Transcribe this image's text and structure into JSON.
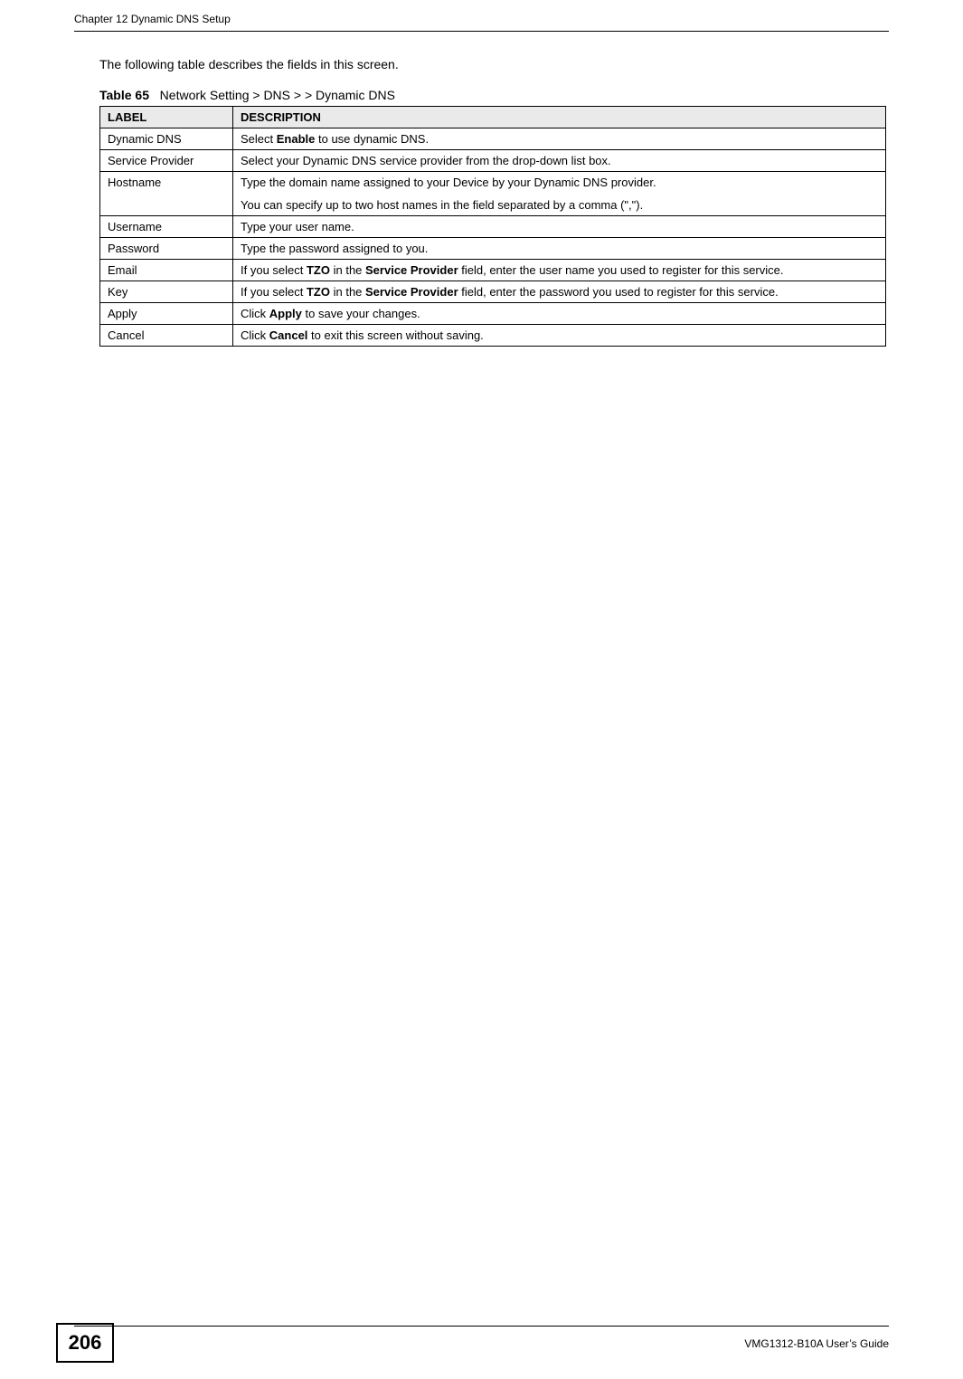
{
  "header": {
    "chapter": "Chapter 12 Dynamic DNS Setup"
  },
  "intro": "The following table describes the fields in this screen.",
  "table": {
    "caption_label": "Table 65",
    "caption_text": "Network Setting > DNS > > Dynamic DNS",
    "headers": {
      "label": "LABEL",
      "description": "DESCRIPTION"
    },
    "rows": {
      "dynamic_dns": {
        "label": "Dynamic DNS",
        "desc_pre": "Select ",
        "desc_bold": "Enable",
        "desc_post": " to use dynamic DNS."
      },
      "service_provider": {
        "label": "Service Provider",
        "desc": "Select your Dynamic DNS service provider from the drop-down list box."
      },
      "hostname": {
        "label": "Hostname",
        "p1": "Type the domain name assigned to your Device by your Dynamic DNS provider.",
        "p2": "You can specify up to two host names in the field separated by a comma (\",\")."
      },
      "username": {
        "label": "Username",
        "desc": "Type your user name."
      },
      "password": {
        "label": "Password",
        "desc": "Type the password assigned to you."
      },
      "email": {
        "label": "Email",
        "pre": "If you select ",
        "b1": "TZO",
        "mid1": " in the ",
        "b2": "Service Provider",
        "post": " field, enter the user name you used to register for this service."
      },
      "key": {
        "label": "Key",
        "pre": "If you select ",
        "b1": "TZO",
        "mid1": " in the ",
        "b2": "Service Provider",
        "post": " field, enter the password you used to register for this service."
      },
      "apply": {
        "label": "Apply",
        "pre": "Click ",
        "b1": "Apply",
        "post": " to save your changes."
      },
      "cancel": {
        "label": "Cancel",
        "pre": "Click ",
        "b1": "Cancel",
        "post": " to exit this screen without saving."
      }
    }
  },
  "footer": {
    "page_number": "206",
    "guide": "VMG1312-B10A User’s Guide"
  }
}
